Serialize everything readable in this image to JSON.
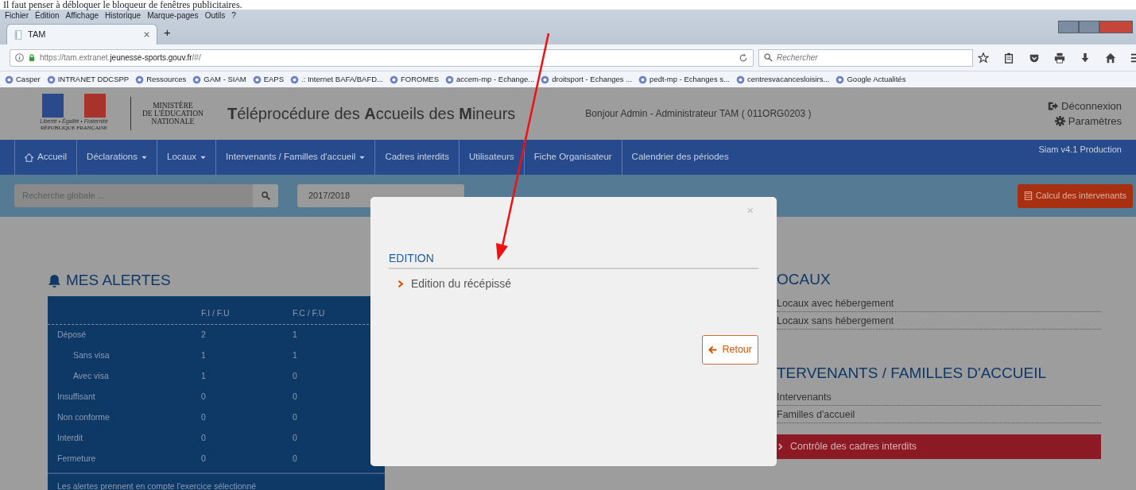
{
  "document_caption": "Il faut penser à débloquer le bloqueur de fenêtres publicitaires.",
  "browser": {
    "menu": [
      "Fichier",
      "Édition",
      "Affichage",
      "Historique",
      "Marque-pages",
      "Outils",
      "?"
    ],
    "tabs": [
      {
        "label": "TAM",
        "selected": true
      }
    ],
    "new_tab": "+",
    "url": {
      "prefix": "https://tam.extranet.",
      "domain": "jeunesse-sports.gouv.fr",
      "suffix": "/#/"
    },
    "search": {
      "placeholder": "Rechercher"
    },
    "bookmarks": [
      "Casper",
      "INTRANET DDCSPP",
      "Ressources",
      "GAM - SIAM",
      "EAPS",
      ".: Internet BAFA/BAFD...",
      "FOROMES",
      "accem-mp - Echange...",
      "droitsport - Echanges ...",
      "pedt-mp - Echanges s...",
      "centresvacancesloisirs...",
      "Google Actualités"
    ]
  },
  "app": {
    "logo": {
      "motto": "Liberté • Égalité • Fraternité",
      "republic": "RÉPUBLIQUE FRANÇAISE",
      "ministry": [
        "MINISTÈRE",
        "DE L'ÉDUCATION",
        "NATIONALE"
      ]
    },
    "title": "**T**éléprocédure des **A**ccueils des **M**ineurs",
    "greeting": "Bonjour Admin - Administrateur TAM ( 011ORG0203 )",
    "user_links": [
      "Déconnexion",
      "Paramètres"
    ],
    "nav": [
      {
        "label": "Accueil",
        "dropdown": false
      },
      {
        "label": "Déclarations",
        "dropdown": true
      },
      {
        "label": "Locaux",
        "dropdown": true
      },
      {
        "label": "Intervenants / Familles d'accueil",
        "dropdown": true
      },
      {
        "label": "Cadres interdits",
        "dropdown": false
      },
      {
        "label": "Utilisateurs",
        "dropdown": false
      },
      {
        "label": "Fiche Organisateur",
        "dropdown": false
      },
      {
        "label": "Calendrier des périodes",
        "dropdown": false
      }
    ],
    "version": "Siam v4.1 Production",
    "global_search": {
      "placeholder": "Recherche globale ..."
    },
    "year_select": "2017/2018",
    "calc_button": "Calcul des intervenants",
    "alerts": {
      "title": "MES ALERTES",
      "columns": [
        "F.I / F.U",
        "F.C / F.U"
      ],
      "rows": [
        {
          "label": "Déposé",
          "values": [
            "2",
            "1"
          ],
          "children": [
            {
              "label": "Sans visa",
              "values": [
                "1",
                "1"
              ]
            },
            {
              "label": "Avec visa",
              "values": [
                "1",
                "0"
              ]
            }
          ]
        },
        {
          "label": "Insuffisant",
          "values": [
            "0",
            "0"
          ]
        },
        {
          "label": "Non conforme",
          "values": [
            "0",
            "0"
          ]
        },
        {
          "label": "Interdit",
          "values": [
            "0",
            "0"
          ]
        },
        {
          "label": "Fermeture",
          "values": [
            "0",
            "0"
          ]
        }
      ],
      "note": "Les alertes prennent en compte l'exercice sélectionné"
    },
    "sections": [
      {
        "title": "OCAUX",
        "items": [
          {
            "label": "Locaux avec hébergement",
            "highlighted": false
          },
          {
            "label": "Locaux sans hébergement",
            "highlighted": false
          }
        ]
      },
      {
        "title": "TERVENANTS / FAMILLES D'ACCUEIL",
        "items": [
          {
            "label": "Intervenants",
            "highlighted": false
          },
          {
            "label": "Familles d'accueil",
            "highlighted": false
          },
          {
            "label": "Contrôle des cadres interdits",
            "highlighted": true
          }
        ]
      }
    ]
  },
  "modal": {
    "close": "×",
    "section": "EDITION",
    "items": [
      "Edition du récépissé"
    ],
    "button": "Retour"
  }
}
